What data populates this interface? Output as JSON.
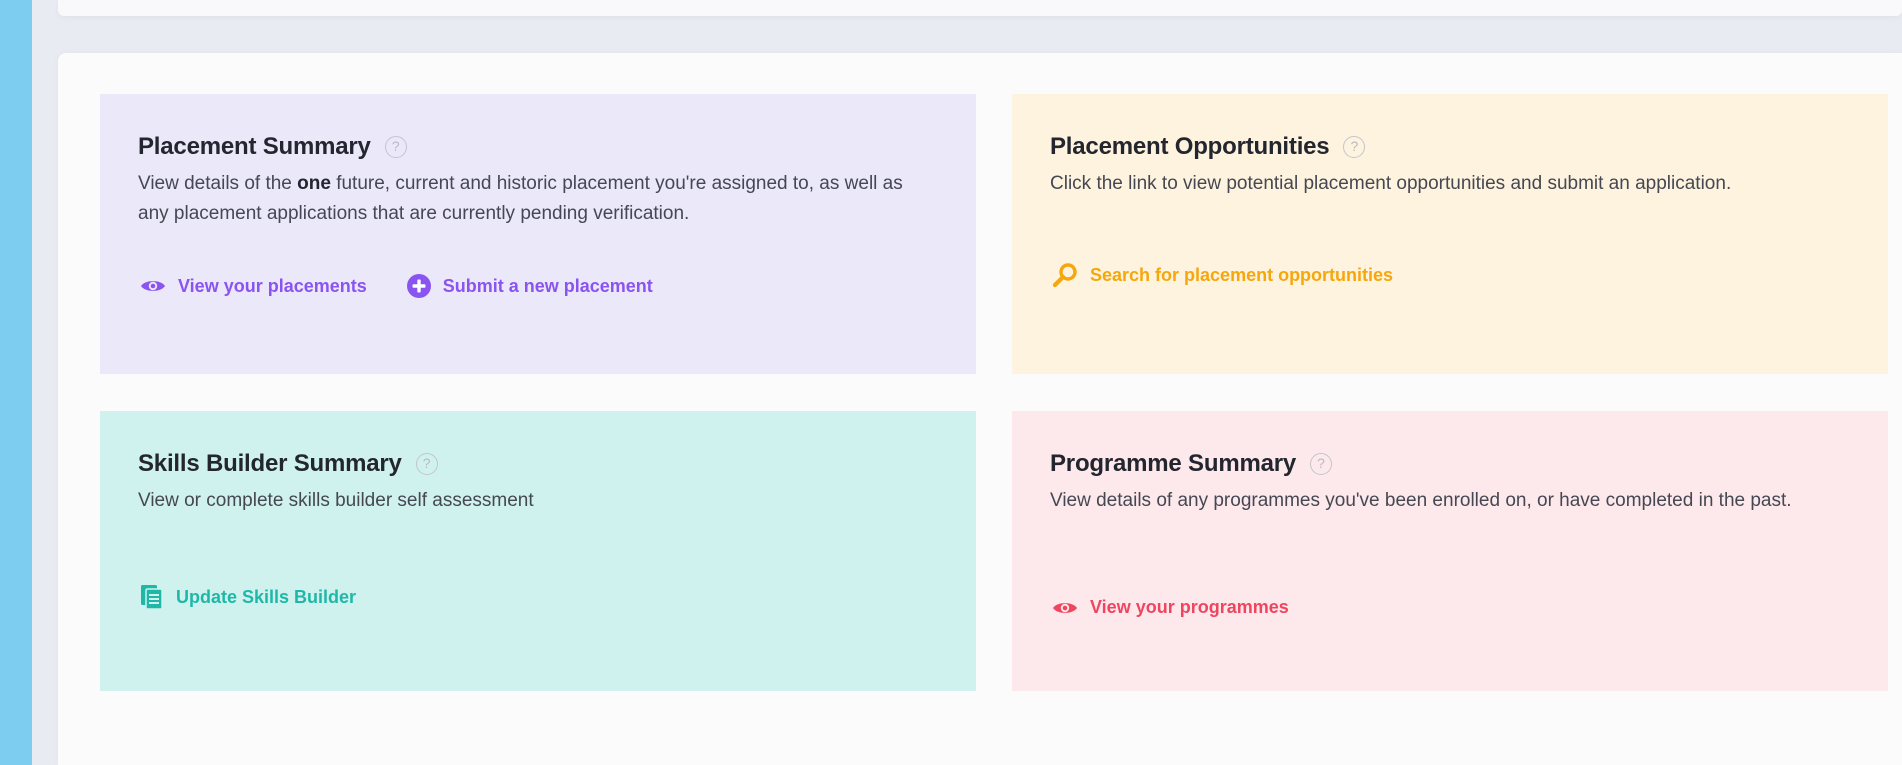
{
  "placement_summary": {
    "title": "Placement Summary",
    "help": "?",
    "desc_before": "View details of the ",
    "desc_bold": "one",
    "desc_after": " future, current and historic placement you're assigned to, as well as any placement applications that are currently pending verification.",
    "links": {
      "view": {
        "label": "View your placements",
        "icon": "eye-icon"
      },
      "submit": {
        "label": "Submit a new placement",
        "icon": "plus-circle-icon"
      }
    },
    "accent": "#8a54f0",
    "background": "#ebe8f9"
  },
  "placement_opportunities": {
    "title": "Placement Opportunities",
    "help": "?",
    "desc": "Click the link to view potential placement opportunities and submit an application.",
    "links": {
      "search": {
        "label": "Search for placement opportunities",
        "icon": "search-icon"
      }
    },
    "accent": "#f5a70c",
    "background": "#fef3de"
  },
  "skills_builder": {
    "title": "Skills Builder Summary",
    "help": "?",
    "desc": "View or complete skills builder self assessment",
    "links": {
      "update": {
        "label": "Update Skills Builder",
        "icon": "document-icon"
      }
    },
    "accent": "#1fb8a8",
    "background": "#d0f2ef"
  },
  "programme_summary": {
    "title": "Programme Summary",
    "help": "?",
    "desc": "View details of any programmes you've been enrolled on, or have completed in the past.",
    "links": {
      "view": {
        "label": "View your programmes",
        "icon": "eye-icon"
      }
    },
    "accent": "#f0455f",
    "background": "#fde8ec"
  }
}
